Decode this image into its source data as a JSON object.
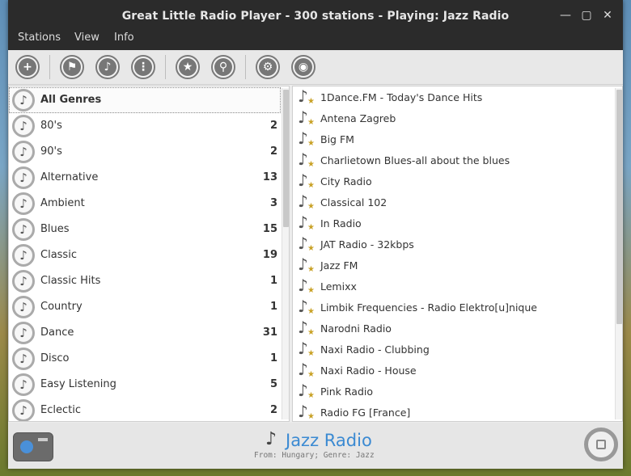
{
  "window": {
    "title": "Great Little Radio Player - 300 stations - Playing: Jazz Radio",
    "controls": [
      "minimize",
      "maximize",
      "close"
    ]
  },
  "menubar": {
    "items": [
      {
        "label": "Stations"
      },
      {
        "label": "View"
      },
      {
        "label": "Info"
      }
    ]
  },
  "toolbar": {
    "buttons": [
      {
        "icon": "add-icon",
        "glyph": "+"
      },
      {
        "icon": "flag-icon",
        "glyph": "⚑"
      },
      {
        "icon": "music-note-icon",
        "glyph": "♪"
      },
      {
        "icon": "list-icon",
        "glyph": "⋮"
      },
      {
        "icon": "star-icon",
        "glyph": "★"
      },
      {
        "icon": "search-icon",
        "glyph": "⚲"
      },
      {
        "icon": "gear-icon",
        "glyph": "⚙"
      },
      {
        "icon": "palette-icon",
        "glyph": "◉"
      }
    ]
  },
  "genres": [
    {
      "label": "All Genres",
      "count": ""
    },
    {
      "label": "80's",
      "count": "2"
    },
    {
      "label": "90's",
      "count": "2"
    },
    {
      "label": "Alternative",
      "count": "13"
    },
    {
      "label": "Ambient",
      "count": "3"
    },
    {
      "label": "Blues",
      "count": "15"
    },
    {
      "label": "Classic",
      "count": "19"
    },
    {
      "label": "Classic Hits",
      "count": "1"
    },
    {
      "label": "Country",
      "count": "1"
    },
    {
      "label": "Dance",
      "count": "31"
    },
    {
      "label": "Disco",
      "count": "1"
    },
    {
      "label": "Easy Listening",
      "count": "5"
    },
    {
      "label": "Eclectic",
      "count": "2"
    }
  ],
  "stations": [
    {
      "label": "1Dance.FM - Today's Dance Hits"
    },
    {
      "label": "Antena Zagreb"
    },
    {
      "label": "Big FM"
    },
    {
      "label": "Charlietown Blues-all about the blues"
    },
    {
      "label": "City Radio"
    },
    {
      "label": "Classical 102"
    },
    {
      "label": "In Radio"
    },
    {
      "label": "JAT Radio - 32kbps"
    },
    {
      "label": "Jazz FM"
    },
    {
      "label": "Lemixx"
    },
    {
      "label": "Limbik Frequencies - Radio Elektro[u]nique"
    },
    {
      "label": "Narodni Radio"
    },
    {
      "label": "Naxi Radio - Clubbing"
    },
    {
      "label": "Naxi Radio - House"
    },
    {
      "label": "Pink Radio"
    },
    {
      "label": "Radio FG [France]"
    }
  ],
  "now_playing": {
    "title": "Jazz Radio",
    "subtitle": "From: Hungary; Genre: Jazz"
  },
  "colors": {
    "accent": "#3b8ad2",
    "titlebar": "#2b2b2b",
    "favorite_star": "#c9a227"
  }
}
